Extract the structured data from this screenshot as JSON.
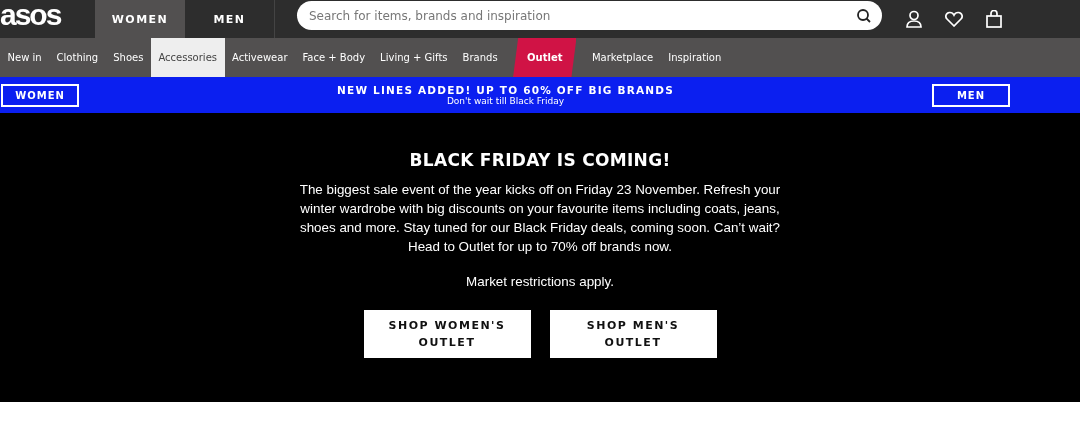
{
  "header": {
    "logo": "asos",
    "gender_tabs": [
      {
        "label": "WOMEN",
        "selected": true
      },
      {
        "label": "MEN",
        "selected": false
      }
    ],
    "search": {
      "placeholder": "Search for items, brands and inspiration"
    }
  },
  "nav": {
    "items": [
      {
        "label": "New in",
        "kind": "link",
        "selected": false
      },
      {
        "label": "Clothing",
        "kind": "link",
        "selected": false
      },
      {
        "label": "Shoes",
        "kind": "link",
        "selected": false
      },
      {
        "label": "Accessories",
        "kind": "link",
        "selected": true
      },
      {
        "label": "Activewear",
        "kind": "link",
        "selected": false
      },
      {
        "label": "Face + Body",
        "kind": "link",
        "selected": false
      },
      {
        "label": "Living + Gifts",
        "kind": "link",
        "selected": false
      },
      {
        "label": "Brands",
        "kind": "link",
        "selected": false
      },
      {
        "label": "Outlet",
        "kind": "sale",
        "selected": false
      },
      {
        "label": "Marketplace",
        "kind": "link",
        "selected": false
      },
      {
        "label": "Inspiration",
        "kind": "link",
        "selected": false
      }
    ]
  },
  "promo_bar": {
    "left_button": "WOMEN",
    "headline": "NEW LINES ADDED! UP TO 60% OFF BIG BRANDS",
    "subline": "Don't wait till Black Friday",
    "right_button": "MEN"
  },
  "hero": {
    "title": "BLACK FRIDAY IS COMING!",
    "body": "The biggest sale event of the year kicks off on Friday 23 November. Refresh your winter wardrobe with big discounts on your favourite items including coats, jeans, shoes and more. Stay tuned for our Black Friday deals, coming soon. Can’t wait? Head to Outlet for up to 70% off brands now.",
    "note": "Market restrictions apply.",
    "buttons": [
      "SHOP WOMEN'S OUTLET",
      "SHOP MEN'S OUTLET"
    ]
  }
}
